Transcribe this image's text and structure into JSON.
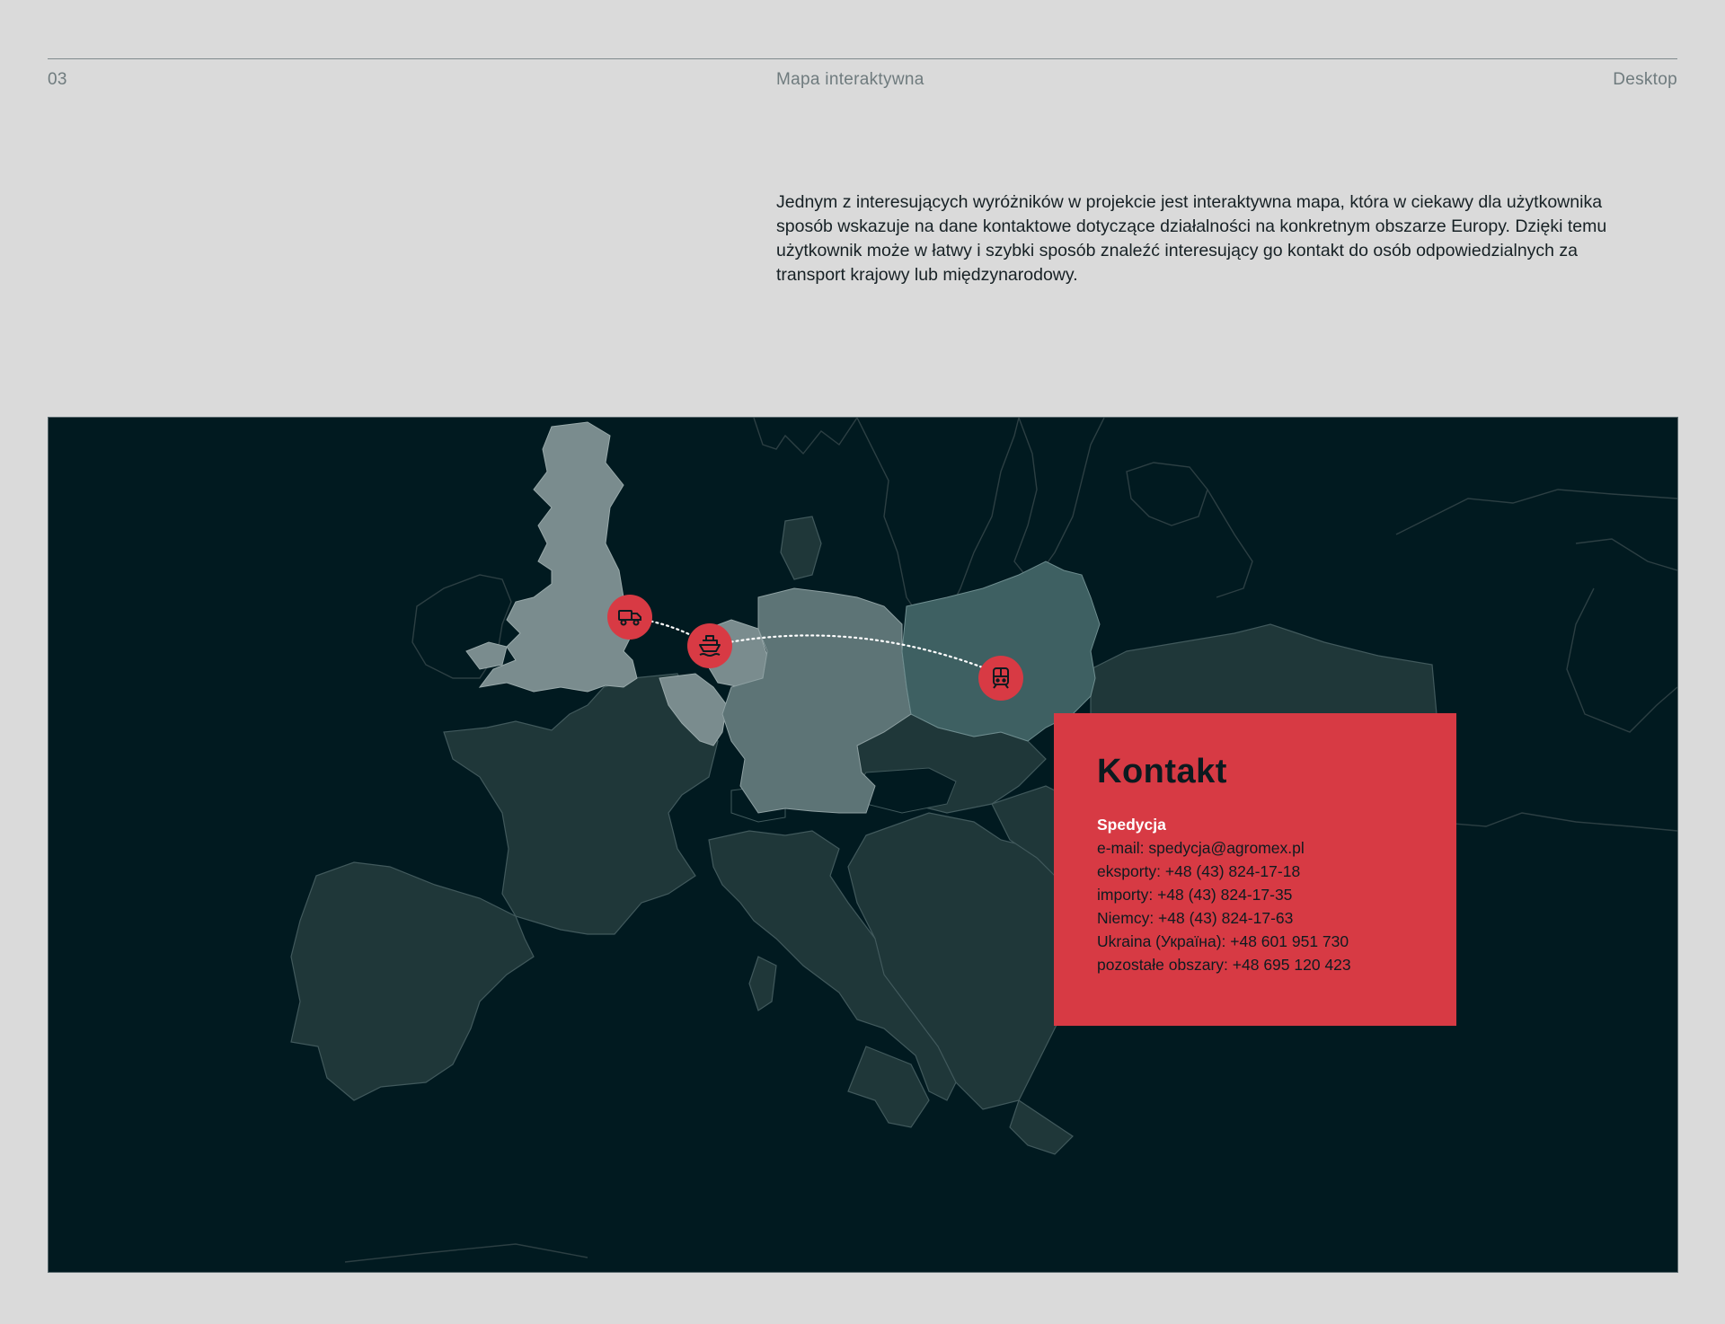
{
  "header": {
    "page_number": "03",
    "title": "Mapa interaktywna",
    "device": "Desktop"
  },
  "intro": {
    "text": "Jednym z interesujących wyróżników w projekcie jest interaktywna mapa, która w ciekawy dla użytkownika sposób wskazuje na dane kontaktowe dotyczące działalności na konkretnym obszarze Europy. Dzięki temu użytkownik może w łatwy i szybki sposób znaleźć interesujący go kontakt do osób odpowiedzialnych za transport krajowy lub międzynarodowy."
  },
  "map": {
    "pins": [
      {
        "icon": "truck-icon"
      },
      {
        "icon": "ship-icon"
      },
      {
        "icon": "train-icon"
      }
    ],
    "colors": {
      "background": "#011a20",
      "country_default": "#1f3739",
      "country_highlight_light": "#7a8c8e",
      "country_highlight_mid": "#5d7476",
      "country_active": "#3e6062",
      "pin": "#d83a44"
    }
  },
  "contact": {
    "title": "Kontakt",
    "department": "Spedycja",
    "email": "e-mail: spedycja@agromex.pl",
    "exports": "eksporty: +48 (43) 824-17-18",
    "imports": "importy: +48 (43) 824-17-35",
    "germany": "Niemcy: +48 (43) 824-17-63",
    "ukraine": "Ukraina (Україна): +48 601 951 730",
    "other": "pozostałe obszary: +48 695 120 423",
    "color": "#d73a44"
  }
}
